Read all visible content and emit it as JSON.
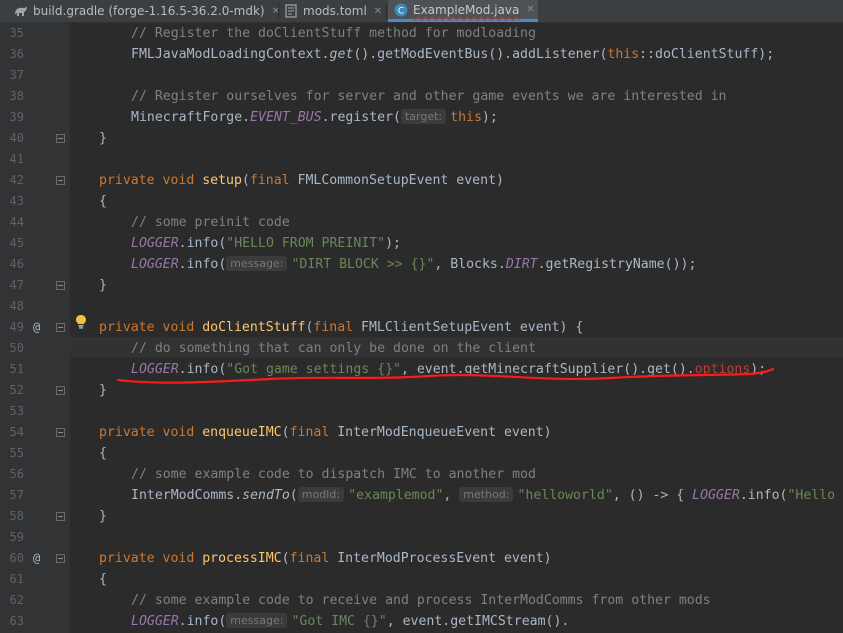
{
  "tabs": [
    {
      "label": "build.gradle (forge-1.16.5-36.2.0-mdk)",
      "icon": "gradle-icon",
      "close": "✕"
    },
    {
      "label": "mods.toml",
      "icon": "toml-file-icon",
      "close": "✕"
    },
    {
      "label": "ExampleMod.java",
      "icon": "java-class-icon",
      "close": "✕"
    }
  ],
  "gutter": {
    "line_numbers": [
      "35",
      "36",
      "37",
      "38",
      "39",
      "40",
      "41",
      "42",
      "43",
      "44",
      "45",
      "46",
      "47",
      "48",
      "49",
      "50",
      "51",
      "52",
      "53",
      "54",
      "55",
      "56",
      "57",
      "58",
      "59",
      "60",
      "61",
      "62",
      "63"
    ],
    "override_mark": "@"
  },
  "code": {
    "l35": "// Register the doClientStuff method for modloading",
    "l36a": "FMLJavaModLoadingContext.",
    "l36b": "get",
    "l36c": "().getModEventBus().addListener(",
    "l36d": "this",
    "l36e": "::doClientStuff);",
    "l38": "// Register ourselves for server and other game events we are interested in",
    "l39a": "MinecraftForge.",
    "l39b": "EVENT_BUS",
    "l39c": ".register(",
    "l39hint": "target:",
    "l39d": "this",
    "l39e": ");",
    "l40": "}",
    "l42a": "private void ",
    "l42b": "setup",
    "l42c": "(",
    "l42d": "final ",
    "l42e": "FMLCommonSetupEvent event)",
    "l43": "{",
    "l44": "// some preinit code",
    "l45a": "LOGGER",
    "l45b": ".info(",
    "l45c": "\"HELLO FROM PREINIT\"",
    "l45d": ");",
    "l46a": "LOGGER",
    "l46b": ".info(",
    "l46hint": "message:",
    "l46c": "\"DIRT BLOCK >> {}\"",
    "l46d": ", Blocks.",
    "l46e": "DIRT",
    "l46f": ".getRegistryName());",
    "l47": "}",
    "l49a": "private void ",
    "l49b": "doClientStuff",
    "l49c": "(",
    "l49d": "final ",
    "l49e": "FMLClientSetupEvent event) {",
    "l50": "// do something that can only be done on the client",
    "l51a": "LOGGER",
    "l51b": ".info(",
    "l51c": "\"Got game settings {}\"",
    "l51d": ", event.getMinecraftSupplier().get().",
    "l51e": "options",
    "l51f": ");",
    "l52": "}",
    "l54a": "private void ",
    "l54b": "enqueueIMC",
    "l54c": "(",
    "l54d": "final ",
    "l54e": "InterModEnqueueEvent event)",
    "l55": "{",
    "l56": "// some example code to dispatch IMC to another mod",
    "l57a": "InterModComms.",
    "l57b": "sendTo",
    "l57c": "(",
    "l57hint1": "modId:",
    "l57d": "\"examplemod\"",
    "l57e": ", ",
    "l57hint2": "method:",
    "l57f": "\"helloworld\"",
    "l57g": ", () -> { ",
    "l57h": "LOGGER",
    "l57i": ".info(",
    "l57j": "\"Hello",
    "l58": "}",
    "l60a": "private void ",
    "l60b": "processIMC",
    "l60c": "(",
    "l60d": "final ",
    "l60e": "InterModProcessEvent event)",
    "l61": "{",
    "l62": "// some example code to receive and process InterModComms from other mods",
    "l63a": "LOGGER",
    "l63b": ".info(",
    "l63hint": "message:",
    "l63c": "\"Got IMC {}\"",
    "l63d": ", event.getIMCStream()."
  },
  "colors": {
    "background": "#2b2b2b",
    "keyword": "#cc7832",
    "string": "#6a8759",
    "comment": "#808080",
    "method": "#ffc66d",
    "field": "#9876aa",
    "annotation_red": "#ff0000"
  }
}
